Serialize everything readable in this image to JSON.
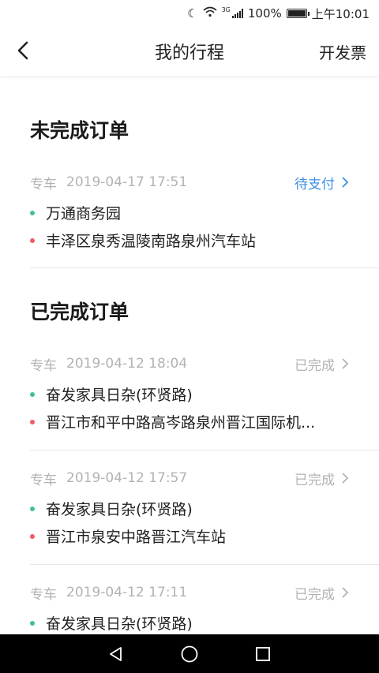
{
  "status_bar": {
    "network": "3G",
    "battery": "100%",
    "time": "上午10:01"
  },
  "header": {
    "title": "我的行程",
    "invoice_label": "开发票"
  },
  "sections": {
    "incomplete": {
      "title": "未完成订单",
      "orders": [
        {
          "type": "专车",
          "datetime": "2019-04-17 17:51",
          "status": "待支付",
          "from": "万通商务园",
          "to": "丰泽区泉秀温陵南路泉州汽车站"
        }
      ]
    },
    "complete": {
      "title": "已完成订单",
      "orders": [
        {
          "type": "专车",
          "datetime": "2019-04-12 18:04",
          "status": "已完成",
          "from": "奋发家具日杂(环贤路)",
          "to": "晋江市和平中路高岑路泉州晋江国际机..."
        },
        {
          "type": "专车",
          "datetime": "2019-04-12 17:57",
          "status": "已完成",
          "from": "奋发家具日杂(环贤路)",
          "to": "晋江市泉安中路晋江汽车站"
        },
        {
          "type": "专车",
          "datetime": "2019-04-12 17:11",
          "status": "已完成",
          "from": "奋发家具日杂(环贤路)"
        }
      ]
    }
  },
  "colors": {
    "pending_status": "#3b8fe6",
    "start_dot": "#3fc194",
    "end_dot": "#f05b67"
  }
}
